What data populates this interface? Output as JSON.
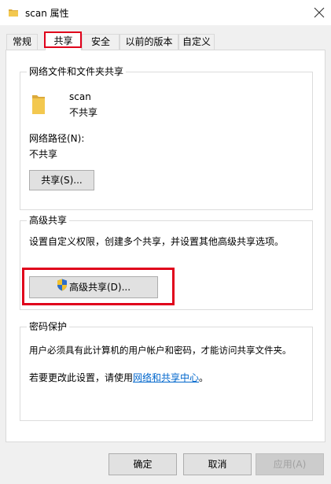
{
  "window": {
    "title": "scan 属性",
    "close_icon": "close-icon",
    "folder_icon": "folder-icon"
  },
  "tabs": [
    {
      "label": "常规",
      "active": false
    },
    {
      "label": "共享",
      "active": true
    },
    {
      "label": "安全",
      "active": false
    },
    {
      "label": "以前的版本",
      "active": false
    },
    {
      "label": "自定义",
      "active": false
    }
  ],
  "network_sharing": {
    "group_label": "网络文件和文件夹共享",
    "folder_name": "scan",
    "folder_status": "不共享",
    "path_label": "网络路径(N):",
    "path_value": "不共享",
    "share_button": "共享(S)..."
  },
  "advanced_sharing": {
    "group_label": "高级共享",
    "description": "设置自定义权限，创建多个共享，并设置其他高级共享选项。",
    "button": "高级共享(D)...",
    "button_icon": "uac-shield-icon"
  },
  "password_protection": {
    "group_label": "密码保护",
    "description": "用户必须具有此计算机的用户帐户和密码，才能访问共享文件夹。",
    "change_prefix": "若要更改此设置，请使用",
    "change_link": "网络和共享中心",
    "change_suffix": "。"
  },
  "footer": {
    "ok": "确定",
    "cancel": "取消",
    "apply": "应用(A)",
    "apply_enabled": false
  },
  "colors": {
    "highlight": "#e0001b",
    "link": "#0066cc",
    "folder": "#f3c84f"
  }
}
